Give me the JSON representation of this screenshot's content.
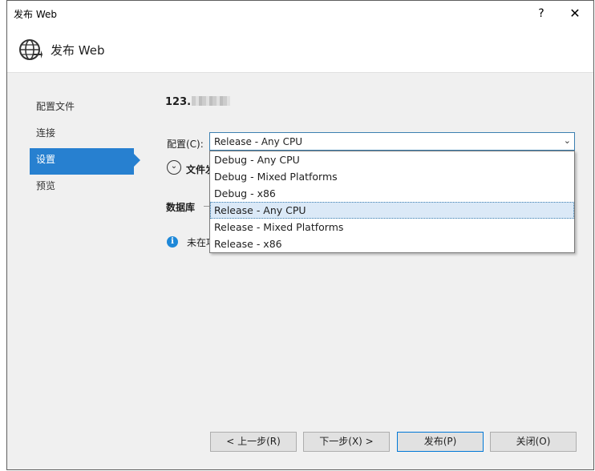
{
  "window": {
    "title": "发布 Web",
    "help_glyph": "?",
    "close_glyph": "✕"
  },
  "header": {
    "title": "发布 Web",
    "icon": "globe-publish-icon"
  },
  "nav": {
    "items": [
      {
        "label": "配置文件",
        "active": false
      },
      {
        "label": "连接",
        "active": false
      },
      {
        "label": "设置",
        "active": true
      },
      {
        "label": "预览",
        "active": false
      }
    ]
  },
  "profile": {
    "name_visible": "123."
  },
  "config": {
    "label": "配置(C):",
    "selected": "Release - Any CPU",
    "options": [
      "Debug - Any CPU",
      "Debug - Mixed Platforms",
      "Debug - x86",
      "Release - Any CPU",
      "Release - Mixed Platforms",
      "Release - x86"
    ],
    "selected_index": 3
  },
  "file_options": {
    "label": "文件发"
  },
  "database": {
    "label": "数据库"
  },
  "info": {
    "text": "未在项"
  },
  "footer": {
    "prev": "< 上一步(R)",
    "next": "下一步(X) >",
    "publish": "发布(P)",
    "close": "关闭(O)"
  },
  "colors": {
    "accent": "#2780d0",
    "dialog_bg": "#f0f0f0",
    "select_border": "#3c7fb1",
    "info": "#1e88d8"
  }
}
